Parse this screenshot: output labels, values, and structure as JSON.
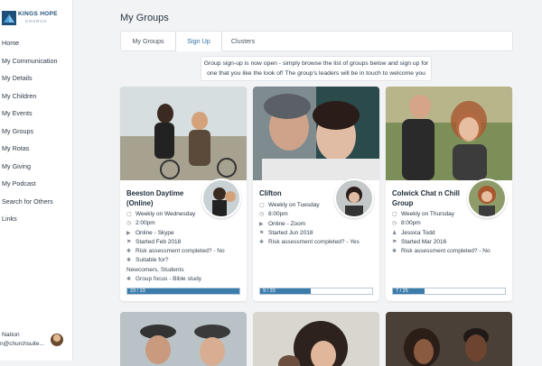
{
  "brand": {
    "name": "KINGS HOPE",
    "sub": "CHURCH"
  },
  "nav": [
    "Home",
    "My Communication",
    "My Details",
    "My Children",
    "My Events",
    "My Groups",
    "My Rotas",
    "My Giving",
    "My Podcast",
    "Search for Others",
    "Links"
  ],
  "user": {
    "name": "Nation",
    "email": "n@churchsuite..."
  },
  "page": {
    "title": "My Groups"
  },
  "tabs": [
    "My Groups",
    "Sign Up",
    "Clusters"
  ],
  "notice": "Group sign-up is now open - simply browse the list of groups below and sign up for one that you like the look of! The group's leaders will be in touch to welcome you",
  "groups": [
    {
      "title": "Beeston Daytime (Online)",
      "details": [
        {
          "icon": "calendar-icon",
          "text": "Weekly on Wednesday"
        },
        {
          "icon": "clock-icon",
          "text": "2:00pm"
        },
        {
          "icon": "video-icon",
          "text": "Online - Skype"
        },
        {
          "icon": "flag-icon",
          "text": "Started Feb 2018"
        },
        {
          "icon": "asterisk-icon",
          "text": "Risk assessment completed? - No"
        },
        {
          "icon": "asterisk-icon",
          "text": "Suitable for?"
        },
        {
          "icon": "",
          "text": "Newcomers, Students"
        },
        {
          "icon": "asterisk-icon",
          "text": "Group focus - Bible study"
        }
      ],
      "progress": {
        "label": "23 / 23",
        "value": 23,
        "max": 23
      }
    },
    {
      "title": "Clifton",
      "details": [
        {
          "icon": "calendar-icon",
          "text": "Weekly on Tuesday"
        },
        {
          "icon": "clock-icon",
          "text": "8:00pm"
        },
        {
          "icon": "video-icon",
          "text": "Online - Zoom"
        },
        {
          "icon": "flag-icon",
          "text": "Started Jun 2018"
        },
        {
          "icon": "asterisk-icon",
          "text": "Risk assessment completed? - Yes"
        }
      ],
      "progress": {
        "label": "9 / 20",
        "value": 9,
        "max": 20
      }
    },
    {
      "title": "Colwick Chat n Chill Group",
      "details": [
        {
          "icon": "calendar-icon",
          "text": "Weekly on Thursday"
        },
        {
          "icon": "clock-icon",
          "text": "8:00pm"
        },
        {
          "icon": "person-icon",
          "text": "Jessica Todd"
        },
        {
          "icon": "flag-icon",
          "text": "Started Mar 2016"
        },
        {
          "icon": "asterisk-icon",
          "text": "Risk assessment completed? - No"
        }
      ],
      "progress": {
        "label": "7 / 25",
        "value": 7,
        "max": 25
      }
    }
  ],
  "colors": {
    "accent": "#3b7cab",
    "brand": "#1f4f78",
    "background": "#f2f3f5"
  }
}
